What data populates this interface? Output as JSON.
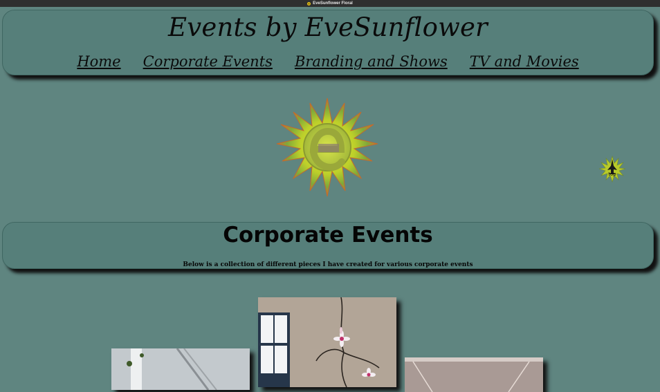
{
  "window": {
    "title": "EveSunflower Floral"
  },
  "header": {
    "site_title": "Events by EveSunflower",
    "nav": [
      {
        "label": "Home"
      },
      {
        "label": "Corporate Events"
      },
      {
        "label": "Branding and Shows"
      },
      {
        "label": "TV and Movies"
      }
    ]
  },
  "top_button": {
    "label": "top"
  },
  "section": {
    "title": "Corporate Events",
    "description": "Below is a collection of different pieces I have created for various corporate events"
  },
  "colors": {
    "background": "#5f8580",
    "panel": "#567f7a",
    "text": "#0a0a0a"
  }
}
